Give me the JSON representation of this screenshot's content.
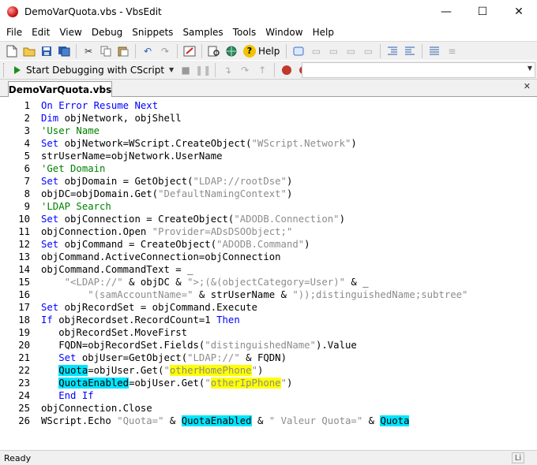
{
  "window": {
    "title": "DemoVarQuota.vbs - VbsEdit",
    "minimize": "—",
    "maximize": "☐",
    "close": "✕"
  },
  "menu": [
    "File",
    "Edit",
    "View",
    "Debug",
    "Snippets",
    "Samples",
    "Tools",
    "Window",
    "Help"
  ],
  "toolbar": {
    "help_label": "Help"
  },
  "debug_toolbar": {
    "start_label": "Start Debugging with CScript"
  },
  "tab": {
    "label": "DemoVarQuota.vbs",
    "close": "✕"
  },
  "status": {
    "text": "Ready"
  },
  "colors": {
    "keyword": "#0000ff",
    "comment": "#008000",
    "string": "#8c8c8c",
    "highlight_cyan": "#00e5ff",
    "highlight_yellow": "#ffff00"
  },
  "code_lines": [
    {
      "n": "1",
      "tokens": [
        {
          "t": "k",
          "v": "On"
        },
        {
          "t": "p",
          "v": " "
        },
        {
          "t": "k",
          "v": "Error"
        },
        {
          "t": "p",
          "v": " "
        },
        {
          "t": "k",
          "v": "Resume"
        },
        {
          "t": "p",
          "v": " "
        },
        {
          "t": "k",
          "v": "Next"
        }
      ]
    },
    {
      "n": "2",
      "tokens": [
        {
          "t": "k",
          "v": "Dim"
        },
        {
          "t": "p",
          "v": " objNetwork, objShell"
        }
      ]
    },
    {
      "n": "3",
      "tokens": [
        {
          "t": "c",
          "v": "'User Name"
        }
      ]
    },
    {
      "n": "4",
      "tokens": [
        {
          "t": "k",
          "v": "Set"
        },
        {
          "t": "p",
          "v": " objNetwork=WScript.CreateObject("
        },
        {
          "t": "s",
          "v": "\"WScript.Network\""
        },
        {
          "t": "p",
          "v": ")"
        }
      ]
    },
    {
      "n": "5",
      "tokens": [
        {
          "t": "p",
          "v": "strUserName=objNetwork.UserName"
        }
      ]
    },
    {
      "n": "6",
      "tokens": [
        {
          "t": "c",
          "v": "'Get Domain"
        }
      ]
    },
    {
      "n": "7",
      "tokens": [
        {
          "t": "k",
          "v": "Set"
        },
        {
          "t": "p",
          "v": " objDomain = GetObject("
        },
        {
          "t": "s",
          "v": "\"LDAP://rootDse\""
        },
        {
          "t": "p",
          "v": ")"
        }
      ]
    },
    {
      "n": "8",
      "tokens": [
        {
          "t": "p",
          "v": "objDC=objDomain.Get("
        },
        {
          "t": "s",
          "v": "\"DefaultNamingContext\""
        },
        {
          "t": "p",
          "v": ")"
        }
      ]
    },
    {
      "n": "9",
      "tokens": [
        {
          "t": "c",
          "v": "'LDAP Search"
        }
      ]
    },
    {
      "n": "10",
      "tokens": [
        {
          "t": "k",
          "v": "Set"
        },
        {
          "t": "p",
          "v": " objConnection = CreateObject("
        },
        {
          "t": "s",
          "v": "\"ADODB.Connection\""
        },
        {
          "t": "p",
          "v": ")"
        }
      ]
    },
    {
      "n": "11",
      "tokens": [
        {
          "t": "p",
          "v": "objConnection.Open "
        },
        {
          "t": "s",
          "v": "\"Provider=ADsDSOObject;\""
        }
      ]
    },
    {
      "n": "12",
      "tokens": [
        {
          "t": "k",
          "v": "Set"
        },
        {
          "t": "p",
          "v": " objCommand = CreateObject("
        },
        {
          "t": "s",
          "v": "\"ADODB.Command\""
        },
        {
          "t": "p",
          "v": ")"
        }
      ]
    },
    {
      "n": "13",
      "tokens": [
        {
          "t": "p",
          "v": "objCommand.ActiveConnection=objConnection"
        }
      ]
    },
    {
      "n": "14",
      "tokens": [
        {
          "t": "p",
          "v": "objCommand.CommandText = _"
        }
      ]
    },
    {
      "n": "15",
      "tokens": [
        {
          "t": "p",
          "v": "    "
        },
        {
          "t": "s",
          "v": "\"<LDAP://\""
        },
        {
          "t": "p",
          "v": " & objDC & "
        },
        {
          "t": "s",
          "v": "\">;(&(objectCategory=User)\""
        },
        {
          "t": "p",
          "v": " & _"
        }
      ]
    },
    {
      "n": "16",
      "tokens": [
        {
          "t": "p",
          "v": "        "
        },
        {
          "t": "s",
          "v": "\"(samAccountName=\""
        },
        {
          "t": "p",
          "v": " & strUserName & "
        },
        {
          "t": "s",
          "v": "\"));distinguishedName;subtree\""
        }
      ]
    },
    {
      "n": "17",
      "tokens": [
        {
          "t": "k",
          "v": "Set"
        },
        {
          "t": "p",
          "v": " objRecordSet = objCommand.Execute"
        }
      ]
    },
    {
      "n": "18",
      "tokens": [
        {
          "t": "k",
          "v": "If"
        },
        {
          "t": "p",
          "v": " objRecordset.RecordCount=1 "
        },
        {
          "t": "k",
          "v": "Then"
        }
      ]
    },
    {
      "n": "19",
      "tokens": [
        {
          "t": "p",
          "v": "   objRecordSet.MoveFirst"
        }
      ]
    },
    {
      "n": "20",
      "tokens": [
        {
          "t": "p",
          "v": "   FQDN=objRecordSet.Fields("
        },
        {
          "t": "s",
          "v": "\"distinguishedName\""
        },
        {
          "t": "p",
          "v": ").Value"
        }
      ]
    },
    {
      "n": "21",
      "tokens": [
        {
          "t": "p",
          "v": "   "
        },
        {
          "t": "k",
          "v": "Set"
        },
        {
          "t": "p",
          "v": " objUser=GetObject("
        },
        {
          "t": "s",
          "v": "\"LDAP://\""
        },
        {
          "t": "p",
          "v": " & FQDN)"
        }
      ]
    },
    {
      "n": "22",
      "tokens": [
        {
          "t": "p",
          "v": "   "
        },
        {
          "t": "hc",
          "v": "Quota"
        },
        {
          "t": "p",
          "v": "=objUser.Get("
        },
        {
          "t": "s",
          "v": "\""
        },
        {
          "t": "hy",
          "v": "otherHomePhone"
        },
        {
          "t": "s",
          "v": "\""
        },
        {
          "t": "p",
          "v": ")"
        }
      ]
    },
    {
      "n": "23",
      "tokens": [
        {
          "t": "p",
          "v": "   "
        },
        {
          "t": "hc",
          "v": "QuotaEnabled"
        },
        {
          "t": "p",
          "v": "=objUser.Get("
        },
        {
          "t": "s",
          "v": "\""
        },
        {
          "t": "hy",
          "v": "otherIpPhone"
        },
        {
          "t": "s",
          "v": "\""
        },
        {
          "t": "p",
          "v": ")"
        }
      ]
    },
    {
      "n": "24",
      "tokens": [
        {
          "t": "p",
          "v": "   "
        },
        {
          "t": "k",
          "v": "End"
        },
        {
          "t": "p",
          "v": " "
        },
        {
          "t": "k",
          "v": "If"
        }
      ]
    },
    {
      "n": "25",
      "tokens": [
        {
          "t": "p",
          "v": "objConnection.Close"
        }
      ]
    },
    {
      "n": "26",
      "tokens": [
        {
          "t": "p",
          "v": "WScript.Echo "
        },
        {
          "t": "s",
          "v": "\"Quota=\""
        },
        {
          "t": "p",
          "v": " & "
        },
        {
          "t": "hc",
          "v": "QuotaEnabled"
        },
        {
          "t": "p",
          "v": " & "
        },
        {
          "t": "s",
          "v": "\" Valeur Quota=\""
        },
        {
          "t": "p",
          "v": " & "
        },
        {
          "t": "hc",
          "v": "Quota"
        }
      ]
    }
  ]
}
